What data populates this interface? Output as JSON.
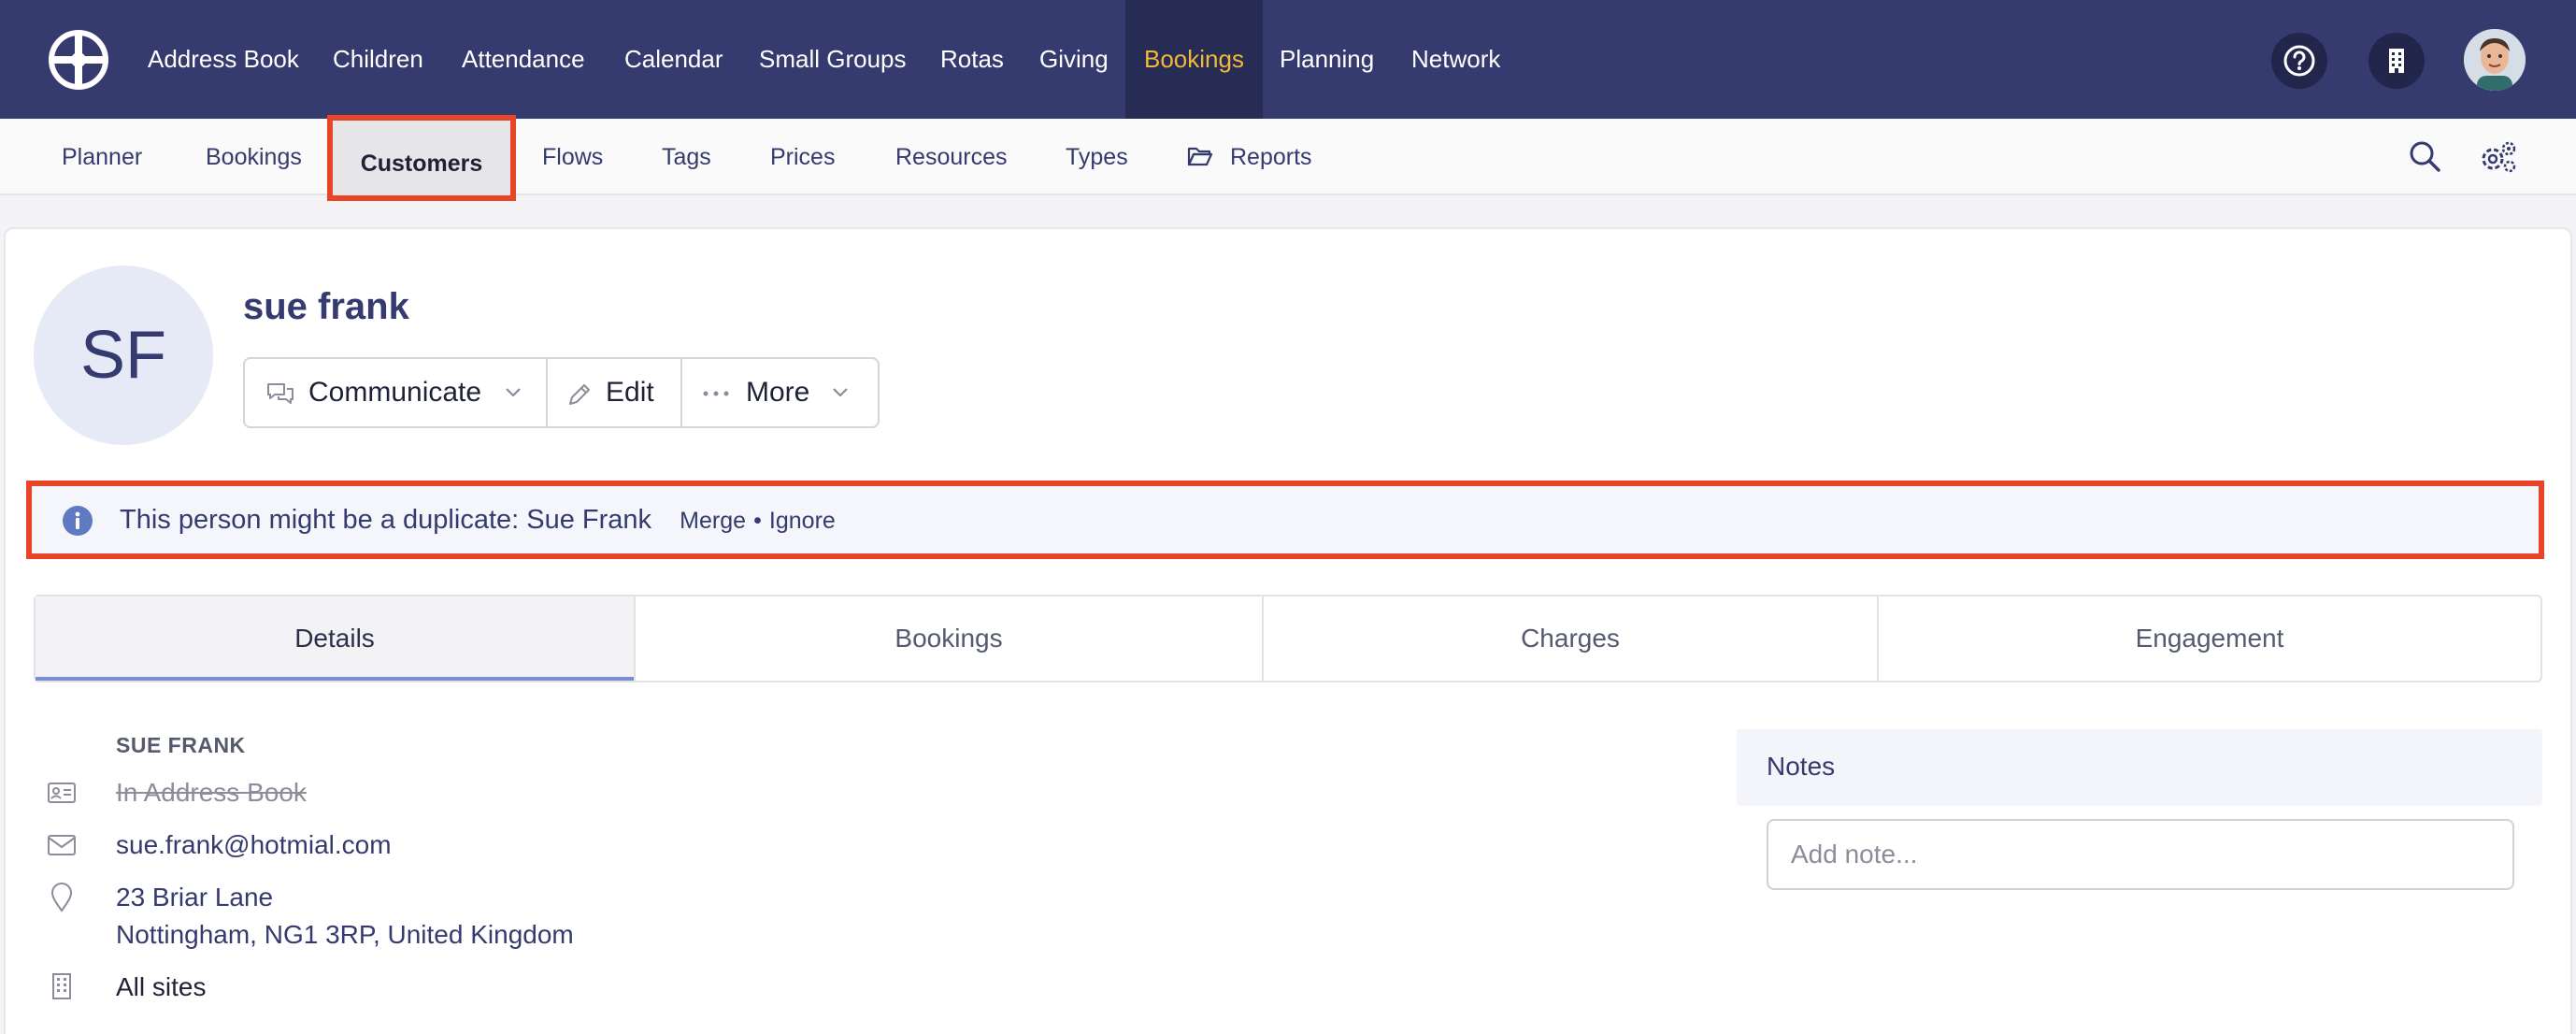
{
  "topnav": {
    "items": [
      {
        "label": "Address Book"
      },
      {
        "label": "Children"
      },
      {
        "label": "Attendance"
      },
      {
        "label": "Calendar"
      },
      {
        "label": "Small Groups"
      },
      {
        "label": "Rotas"
      },
      {
        "label": "Giving"
      },
      {
        "label": "Bookings",
        "active": true
      },
      {
        "label": "Planning"
      },
      {
        "label": "Network"
      }
    ],
    "icons": [
      "help-circle-icon",
      "building-icon",
      "user-avatar"
    ]
  },
  "subnav": {
    "items": [
      {
        "label": "Planner"
      },
      {
        "label": "Bookings"
      },
      {
        "label": "Customers",
        "active": true
      },
      {
        "label": "Flows"
      },
      {
        "label": "Tags"
      },
      {
        "label": "Prices"
      },
      {
        "label": "Resources"
      },
      {
        "label": "Types"
      },
      {
        "label": "Reports",
        "icon": "folder-open-icon"
      }
    ],
    "icons": [
      "search-icon",
      "settings-cogs-icon"
    ]
  },
  "profile": {
    "initials": "SF",
    "name": "sue frank",
    "actions": {
      "communicate": "Communicate",
      "edit": "Edit",
      "more": "More"
    }
  },
  "duplicate_banner": {
    "text": "This person might be a duplicate: Sue Frank",
    "merge": "Merge",
    "separator": "•",
    "ignore": "Ignore"
  },
  "tabs": [
    {
      "label": "Details",
      "active": true
    },
    {
      "label": "Bookings"
    },
    {
      "label": "Charges"
    },
    {
      "label": "Engagement"
    }
  ],
  "details": {
    "heading": "SUE FRANK",
    "address_book": "In Address Book",
    "email": "sue.frank@hotmial.com",
    "address_line1": "23 Briar Lane",
    "address_line2": "Nottingham, NG1 3RP, United Kingdom",
    "sites": "All sites"
  },
  "notes": {
    "title": "Notes",
    "placeholder": "Add note..."
  },
  "colors": {
    "nav_bg": "#353b6e",
    "nav_active_bg": "#272c55",
    "nav_active_text": "#f3b73b",
    "highlight_border": "#e84427",
    "accent": "#353b6e"
  }
}
